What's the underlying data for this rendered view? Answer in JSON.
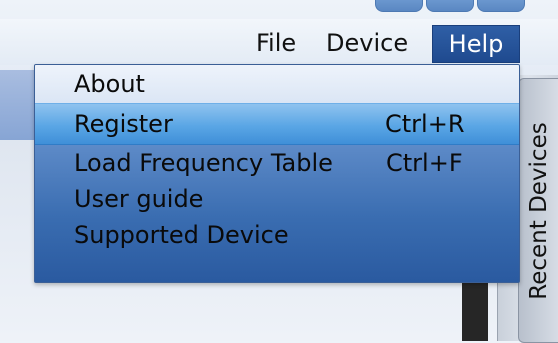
{
  "menubar": {
    "file": "File",
    "device": "Device",
    "help": "Help"
  },
  "help_menu": {
    "items": [
      {
        "label": "About",
        "shortcut": ""
      },
      {
        "label": "Register",
        "shortcut": "Ctrl+R"
      },
      {
        "label": "Load Frequency Table",
        "shortcut": "Ctrl+F"
      },
      {
        "label": "User guide",
        "shortcut": ""
      },
      {
        "label": "Supported Device",
        "shortcut": ""
      }
    ],
    "highlighted_index": 1
  },
  "side_panel": {
    "tab_label": "Recent Devices"
  }
}
